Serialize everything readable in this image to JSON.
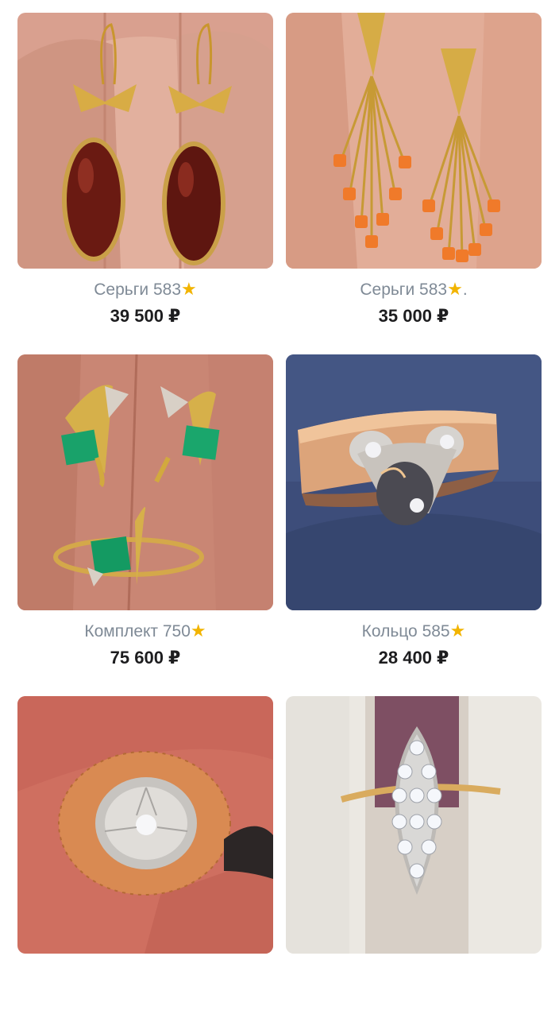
{
  "products": [
    {
      "title": "Серьги 583",
      "suffix": "",
      "price": "39 500 ₽",
      "icon": "star-icon"
    },
    {
      "title": "Серьги 583",
      "suffix": ".",
      "price": "35 000 ₽",
      "icon": "star-icon"
    },
    {
      "title": "Комплект 750",
      "suffix": "",
      "price": "75 600 ₽",
      "icon": "star-icon"
    },
    {
      "title": "Кольцо 585",
      "suffix": "",
      "price": "28 400 ₽",
      "icon": "star-icon"
    },
    {
      "title": "",
      "suffix": "",
      "price": ""
    },
    {
      "title": "",
      "suffix": "",
      "price": ""
    }
  ],
  "colors": {
    "title_gray": "#7f8a96",
    "price": "#1d1d1f",
    "star": "#f2b400"
  }
}
